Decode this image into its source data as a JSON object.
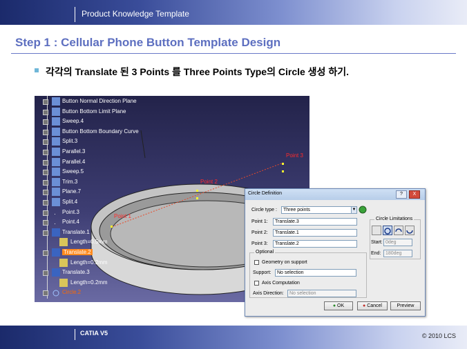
{
  "header": {
    "title": "Product Knowledge Template"
  },
  "slide": {
    "step_title": "Step 1 : Cellular Phone Button Template Design",
    "bullet": "각각의 Translate 된 3 Points 를 Three Points Type의 Circle 생성 하기."
  },
  "footer": {
    "left": "CATIA V5",
    "right": "© 2010 LCS"
  },
  "tree": {
    "items": [
      {
        "label": "Button Normal Direction Plane",
        "icon": "plane-icon",
        "indent": 0
      },
      {
        "label": "Button Bottom Limit Plane",
        "icon": "plane-icon",
        "indent": 0
      },
      {
        "label": "Sweep.4",
        "icon": "sweep-icon",
        "indent": 0
      },
      {
        "label": "Button Bottom Boundary Curve",
        "icon": "curve-icon",
        "indent": 0
      },
      {
        "label": "Split.3",
        "icon": "split-icon",
        "indent": 0
      },
      {
        "label": "Parallel.3",
        "icon": "parallel-icon",
        "indent": 0
      },
      {
        "label": "Parallel.4",
        "icon": "parallel-icon",
        "indent": 0
      },
      {
        "label": "Sweep.5",
        "icon": "sweep-icon",
        "indent": 0
      },
      {
        "label": "Trim.3",
        "icon": "trim-icon",
        "indent": 0
      },
      {
        "label": "Plane.7",
        "icon": "plane-icon",
        "indent": 0
      },
      {
        "label": "Split.4",
        "icon": "split-icon",
        "indent": 0
      },
      {
        "label": "Point.3",
        "icon": "point-icon",
        "indent": 0
      },
      {
        "label": "Point.4",
        "icon": "point-icon",
        "indent": 0
      },
      {
        "label": "Translate.1",
        "icon": "translate-icon",
        "indent": 0
      },
      {
        "label": "Length=0.5mm",
        "icon": "parameter-icon",
        "indent": 1
      },
      {
        "label": "Translate.2",
        "icon": "translate-icon",
        "indent": 0,
        "highlight": true
      },
      {
        "label": "Length=0.2mm",
        "icon": "parameter-icon",
        "indent": 1
      },
      {
        "label": "Translate.3",
        "icon": "translate-icon",
        "indent": 0
      },
      {
        "label": "Length=0.2mm",
        "icon": "parameter-icon",
        "indent": 1
      },
      {
        "label": "Circle.2",
        "icon": "circle-icon",
        "indent": 0,
        "red": true
      }
    ]
  },
  "viewport": {
    "point_labels": [
      "Point 1",
      "Point 2",
      "Point 3"
    ]
  },
  "dialog": {
    "title": "Circle Definition",
    "help_btn": "?",
    "close_btn": "X",
    "circle_type_label": "Circle type :",
    "circle_type_value": "Three points",
    "point1_label": "Point 1:",
    "point1_value": "Translate.3",
    "point2_label": "Point 2:",
    "point2_value": "Translate.1",
    "point3_label": "Point 3:",
    "point3_value": "Translate.2",
    "optional_label": "Optional",
    "geometry_on_support": "Geometry on support",
    "support_label": "Support:",
    "support_value": "No selection",
    "axis_computation": "Axis Computation",
    "axis_direction_label": "Axis Direction:",
    "axis_direction_value": "No selection",
    "limitations_label": "Circle Limitations",
    "start_label": "Start:",
    "start_value": "0deg",
    "end_label": "End:",
    "end_value": "180deg",
    "ok": "OK",
    "cancel": "Cancel",
    "preview": "Preview"
  }
}
